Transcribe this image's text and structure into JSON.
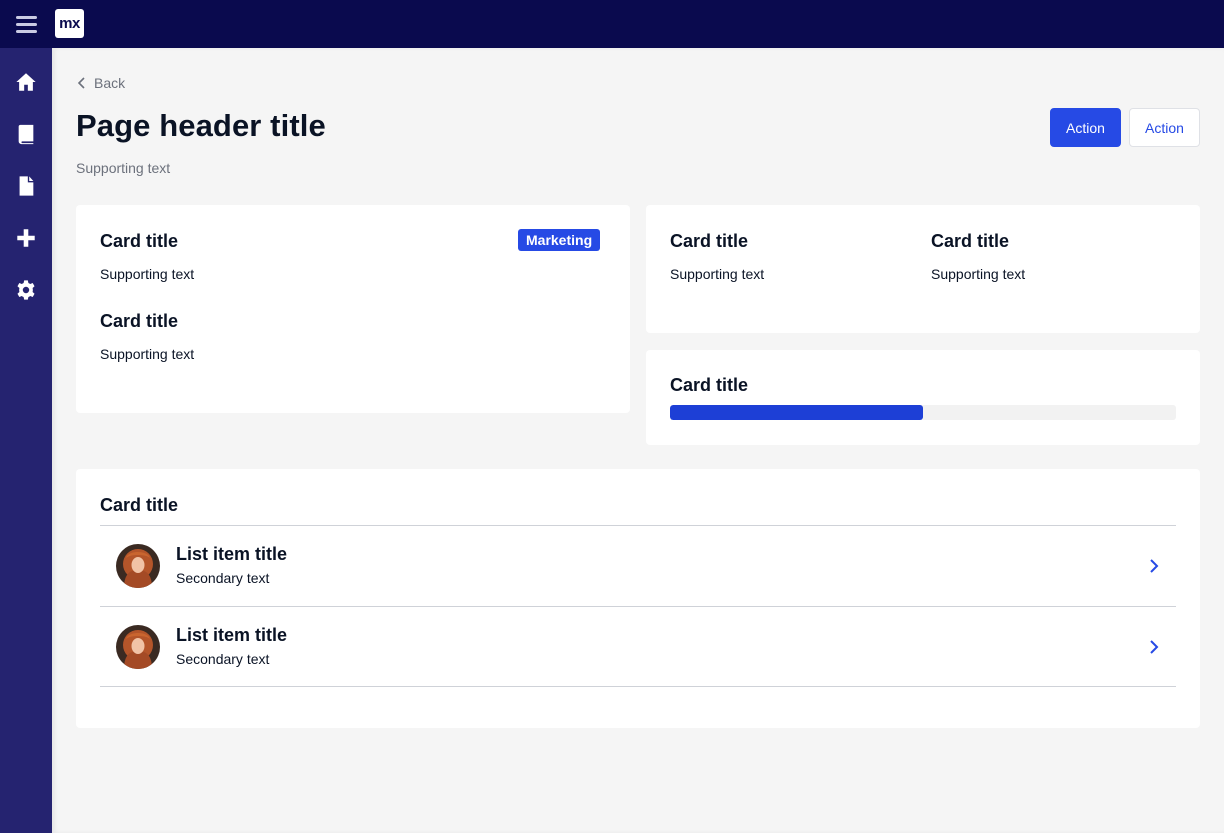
{
  "app": {
    "logo_text": "mx"
  },
  "sidebar": {
    "items": [
      {
        "icon": "home-icon"
      },
      {
        "icon": "book-icon"
      },
      {
        "icon": "file-icon"
      },
      {
        "icon": "plus-icon"
      },
      {
        "icon": "gear-icon"
      }
    ]
  },
  "header": {
    "back_label": "Back",
    "title": "Page header title",
    "subtitle": "Supporting text",
    "primary_action": "Action",
    "secondary_action": "Action"
  },
  "card1": {
    "badge": "Marketing",
    "sections": [
      {
        "title": "Card title",
        "text": "Supporting text"
      },
      {
        "title": "Card title",
        "text": "Supporting text"
      }
    ]
  },
  "card2": {
    "columns": [
      {
        "title": "Card title",
        "text": "Supporting text"
      },
      {
        "title": "Card title",
        "text": "Supporting text"
      }
    ]
  },
  "card3": {
    "title": "Card title",
    "progress": 0.5
  },
  "list_card": {
    "title": "Card title",
    "items": [
      {
        "title": "List item title",
        "secondary": "Secondary text"
      },
      {
        "title": "List item title",
        "secondary": "Secondary text"
      }
    ]
  },
  "colors": {
    "topbar": "#0a0a4e",
    "sidebar": "#252370",
    "accent": "#264ae5",
    "background": "#f5f5f5"
  }
}
